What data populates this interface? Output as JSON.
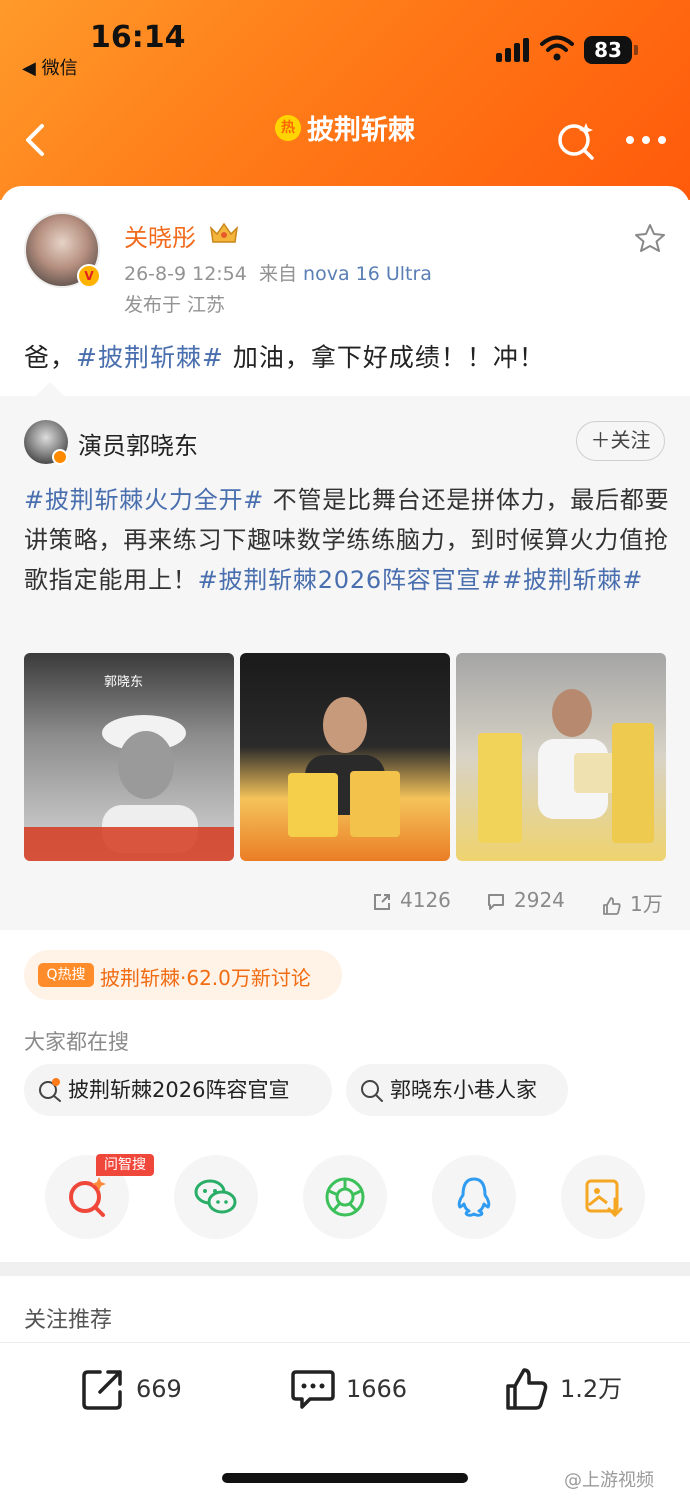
{
  "status_bar": {
    "time": "16:14",
    "back_app": "微信",
    "battery": "83"
  },
  "nav": {
    "title": "披荆斩棘",
    "hot_badge": "热"
  },
  "post": {
    "author": "关晓彤",
    "date": "26-8-9 12:54",
    "source_prefix": "来自",
    "device": "nova 16 Ultra",
    "location": "发布于 江苏",
    "text_pre": "爸，",
    "topic": "#披荆斩棘#",
    "text_post": " 加油，拿下好成绩！！冲！"
  },
  "repost": {
    "author": "演员郭晓东",
    "follow_label": "＋关注",
    "topic1": "#披荆斩棘火力全开#",
    "body": " 不管是比舞台还是拼体力，最后都要讲策略，再来练习下趣味数学练练脑力，到时候算火力值抢歌指定能用上！",
    "topic2": "#披荆斩棘2026阵容官宣##披荆斩棘#",
    "photo_label": "郭晓东",
    "reposts": "4126",
    "comments": "2924",
    "likes": "1万"
  },
  "hot": {
    "tag": "Q热搜",
    "text": "披荆斩棘·62.0万新讨论"
  },
  "search": {
    "title": "大家都在搜",
    "chips": [
      "披荆斩棘2026阵容官宣",
      "郭晓东小巷人家"
    ]
  },
  "share": {
    "ai_badge": "问智搜"
  },
  "recommend_title": "关注推荐",
  "bottom_bar": {
    "reposts": "669",
    "comments": "1666",
    "likes": "1.2万"
  },
  "watermark": "@上游视频",
  "colors": {
    "accent": "#ff7a18",
    "topic": "#4a6fae",
    "name": "#f26b1d"
  }
}
